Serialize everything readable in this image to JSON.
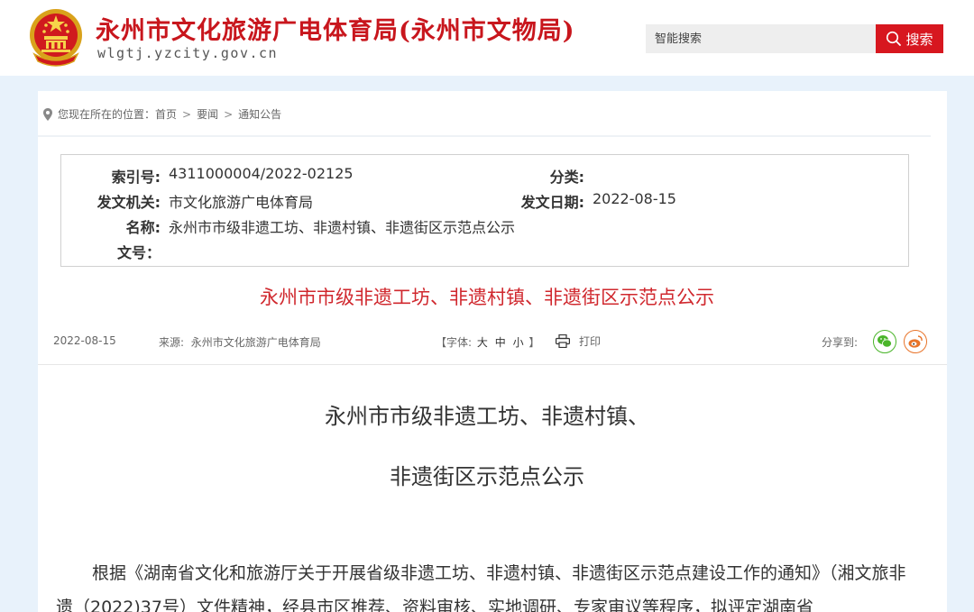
{
  "header": {
    "site_title": "永州市文化旅游广电体育局(永州市文物局)",
    "site_domain": "wlgtj.yzcity.gov.cn",
    "search_placeholder": "智能搜索",
    "search_button": "搜索"
  },
  "breadcrumb": {
    "prefix": "您现在所在的位置：",
    "items": [
      "首页",
      "要闻",
      "通知公告"
    ],
    "separator": ">"
  },
  "meta": {
    "index_label": "索引号:",
    "index_value": "4311000004/2022-02125",
    "category_label": "分类:",
    "category_value": "",
    "issuer_label": "发文机关:",
    "issuer_value": "市文化旅游广电体育局",
    "date_label": "发文日期:",
    "date_value": "2022-08-15",
    "name_label": "名称:",
    "name_value": "永州市市级非遗工坊、非遗村镇、非遗街区示范点公示",
    "docno_label": "文号："
  },
  "article": {
    "title": "永州市市级非遗工坊、非遗村镇、非遗街区示范点公示",
    "date": "2022-08-15",
    "source_label": "来源:",
    "source_value": "永州市文化旅游广电体育局",
    "font_label_open": "【字体:",
    "font_large": "大",
    "font_medium": "中",
    "font_small": "小",
    "font_label_close": "】",
    "print_label": "打印",
    "share_label": "分享到:",
    "doc_title_line1": "永州市市级非遗工坊、非遗村镇、",
    "doc_title_line2": "非遗街区示范点公示",
    "body": "根据《湖南省文化和旅游厅关于开展省级非遗工坊、非遗村镇、非遗街区示范点建设工作的通知》（湘文旅非遗（2022)37号）文件精神，经县市区推荐、资料审核、实地调研、专家审议等程序，拟评定湖南省"
  },
  "colors": {
    "brand_red": "#c8161d",
    "title_red": "#d0282e",
    "page_bg": "#e8f2fb",
    "wechat_green": "#4ab52a",
    "weibo_orange": "#e8742a"
  }
}
